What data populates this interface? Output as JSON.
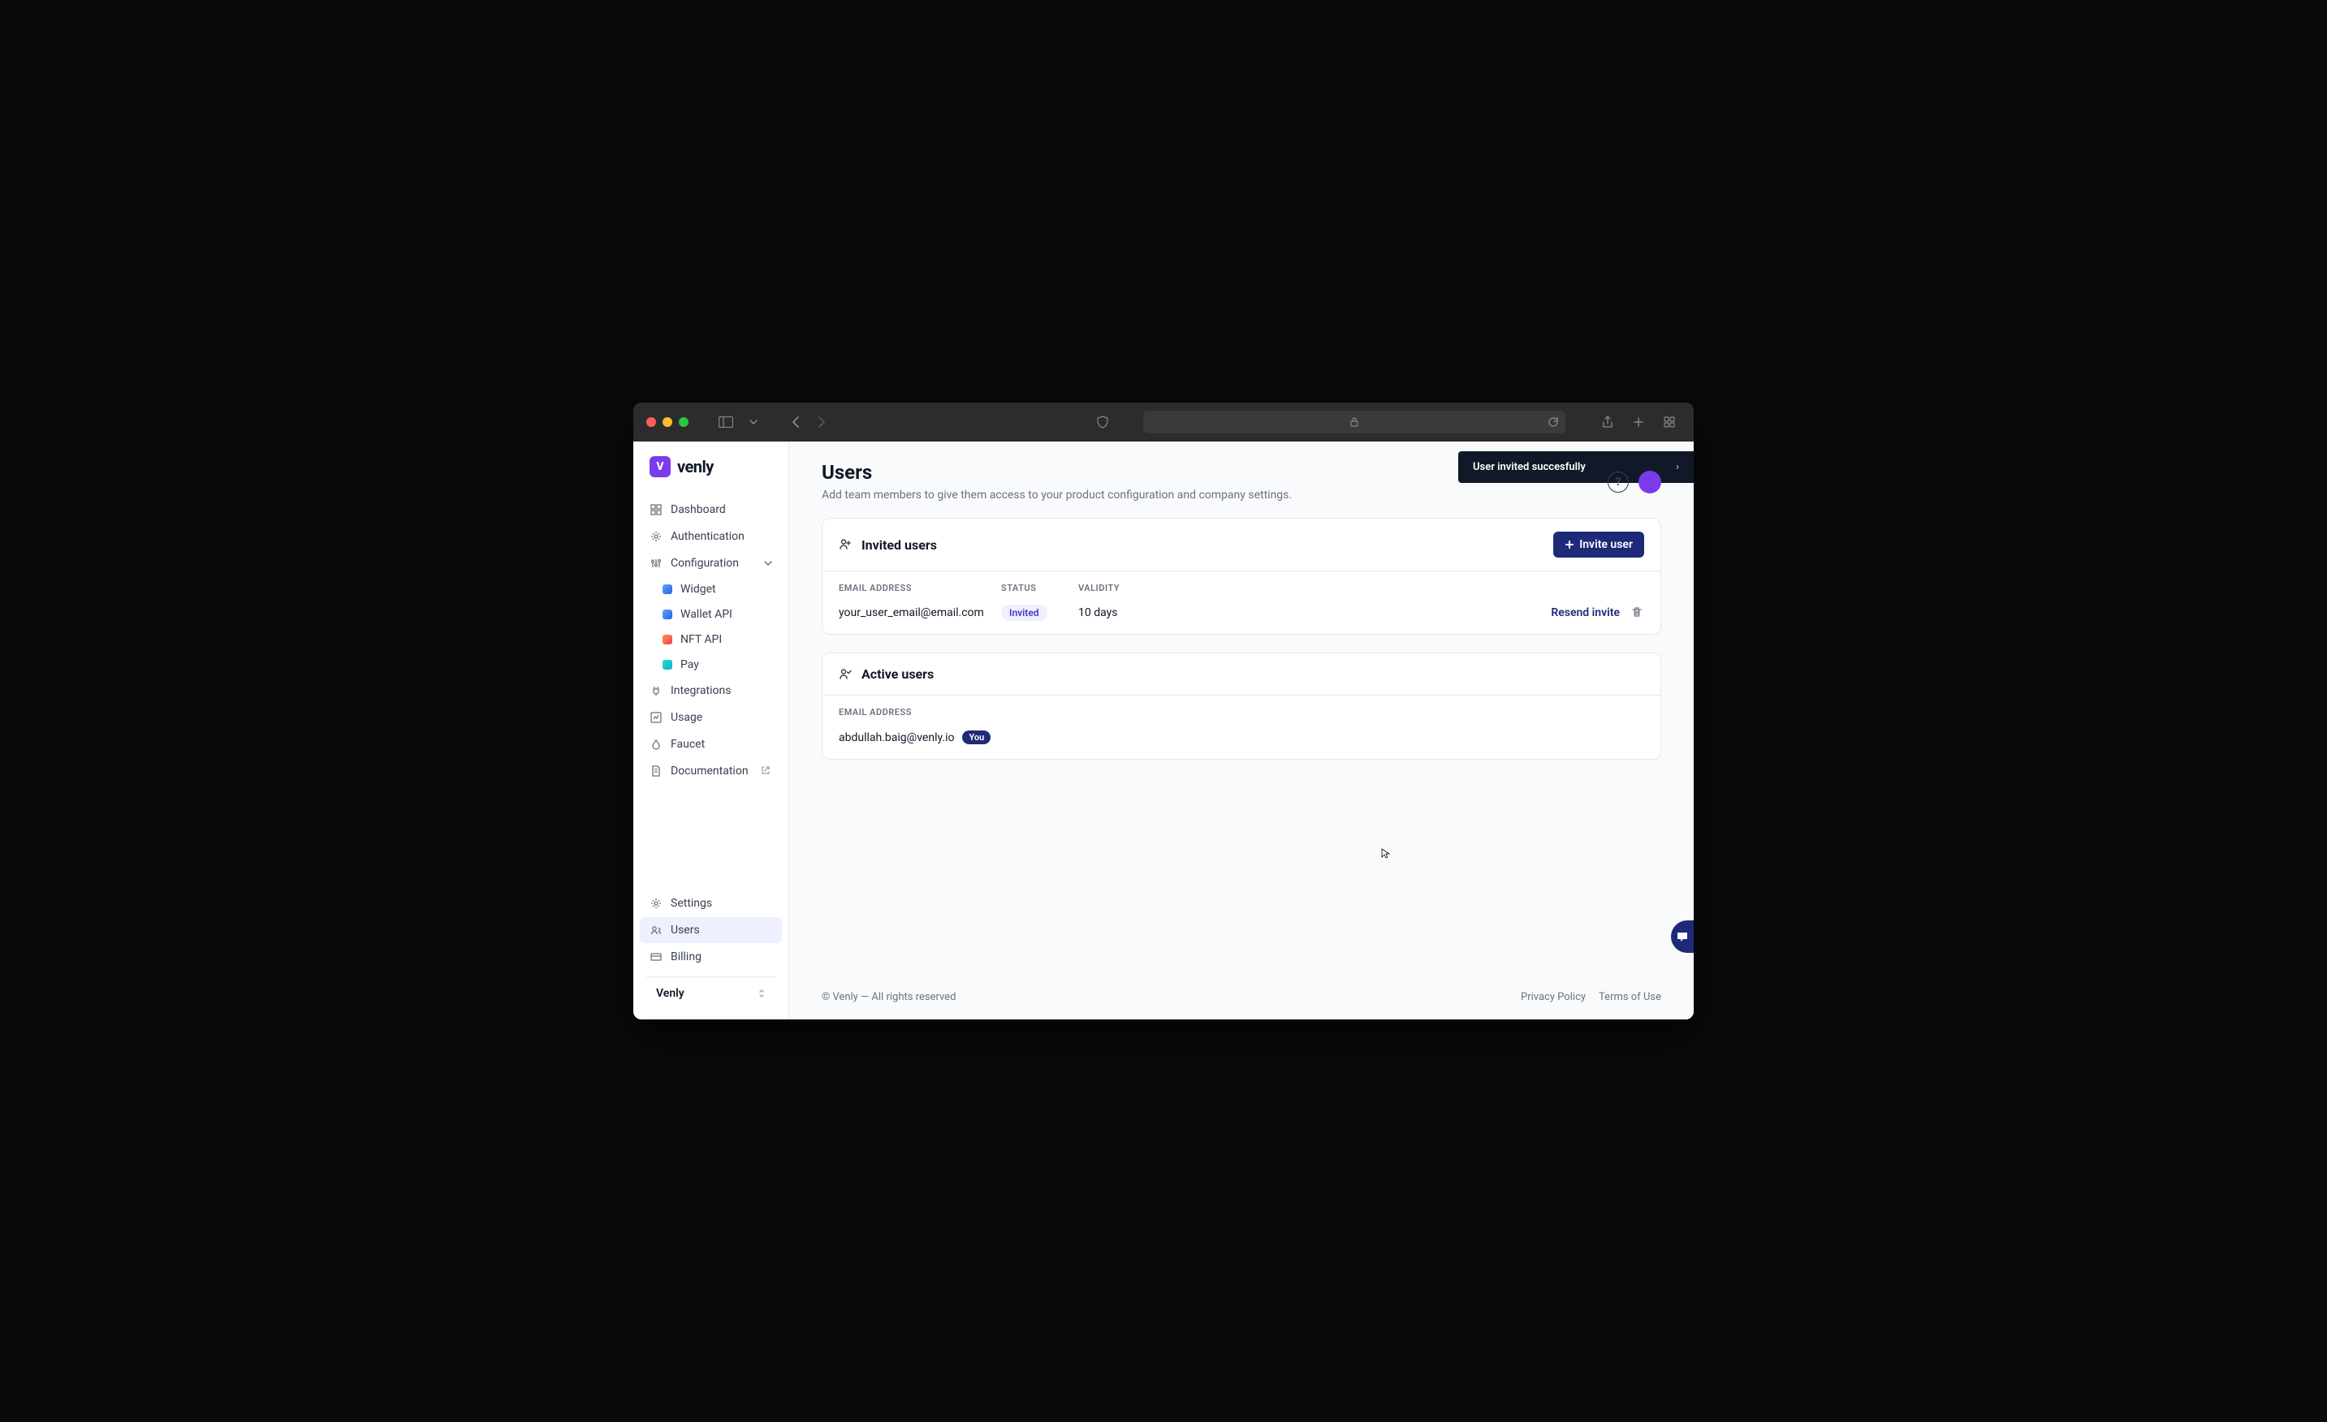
{
  "toast": {
    "message": "User invited succesfully"
  },
  "brand": {
    "name": "venly",
    "mark": "V"
  },
  "sidebar": {
    "main": [
      {
        "label": "Dashboard"
      },
      {
        "label": "Authentication"
      },
      {
        "label": "Configuration"
      },
      {
        "label": "Integrations"
      },
      {
        "label": "Usage"
      },
      {
        "label": "Faucet"
      },
      {
        "label": "Documentation"
      }
    ],
    "config_children": [
      {
        "label": "Widget"
      },
      {
        "label": "Wallet API"
      },
      {
        "label": "NFT API"
      },
      {
        "label": "Pay"
      }
    ],
    "bottom": [
      {
        "label": "Settings"
      },
      {
        "label": "Users"
      },
      {
        "label": "Billing"
      }
    ],
    "workspace": "Venly"
  },
  "page": {
    "title": "Users",
    "subtitle": "Add team members to give them access to your product configuration and company settings."
  },
  "invited": {
    "title": "Invited users",
    "button": "Invite user",
    "headers": {
      "email": "EMAIL ADDRESS",
      "status": "STATUS",
      "validity": "VALIDITY"
    },
    "rows": [
      {
        "email": "your_user_email@email.com",
        "status": "Invited",
        "validity": "10 days",
        "action": "Resend invite"
      }
    ]
  },
  "active": {
    "title": "Active users",
    "headers": {
      "email": "EMAIL ADDRESS"
    },
    "rows": [
      {
        "email": "abdullah.baig@venly.io",
        "you": "You"
      }
    ]
  },
  "footer": {
    "copyright": "© Venly — All rights reserved",
    "links": {
      "privacy": "Privacy Policy",
      "terms": "Terms of Use"
    }
  }
}
